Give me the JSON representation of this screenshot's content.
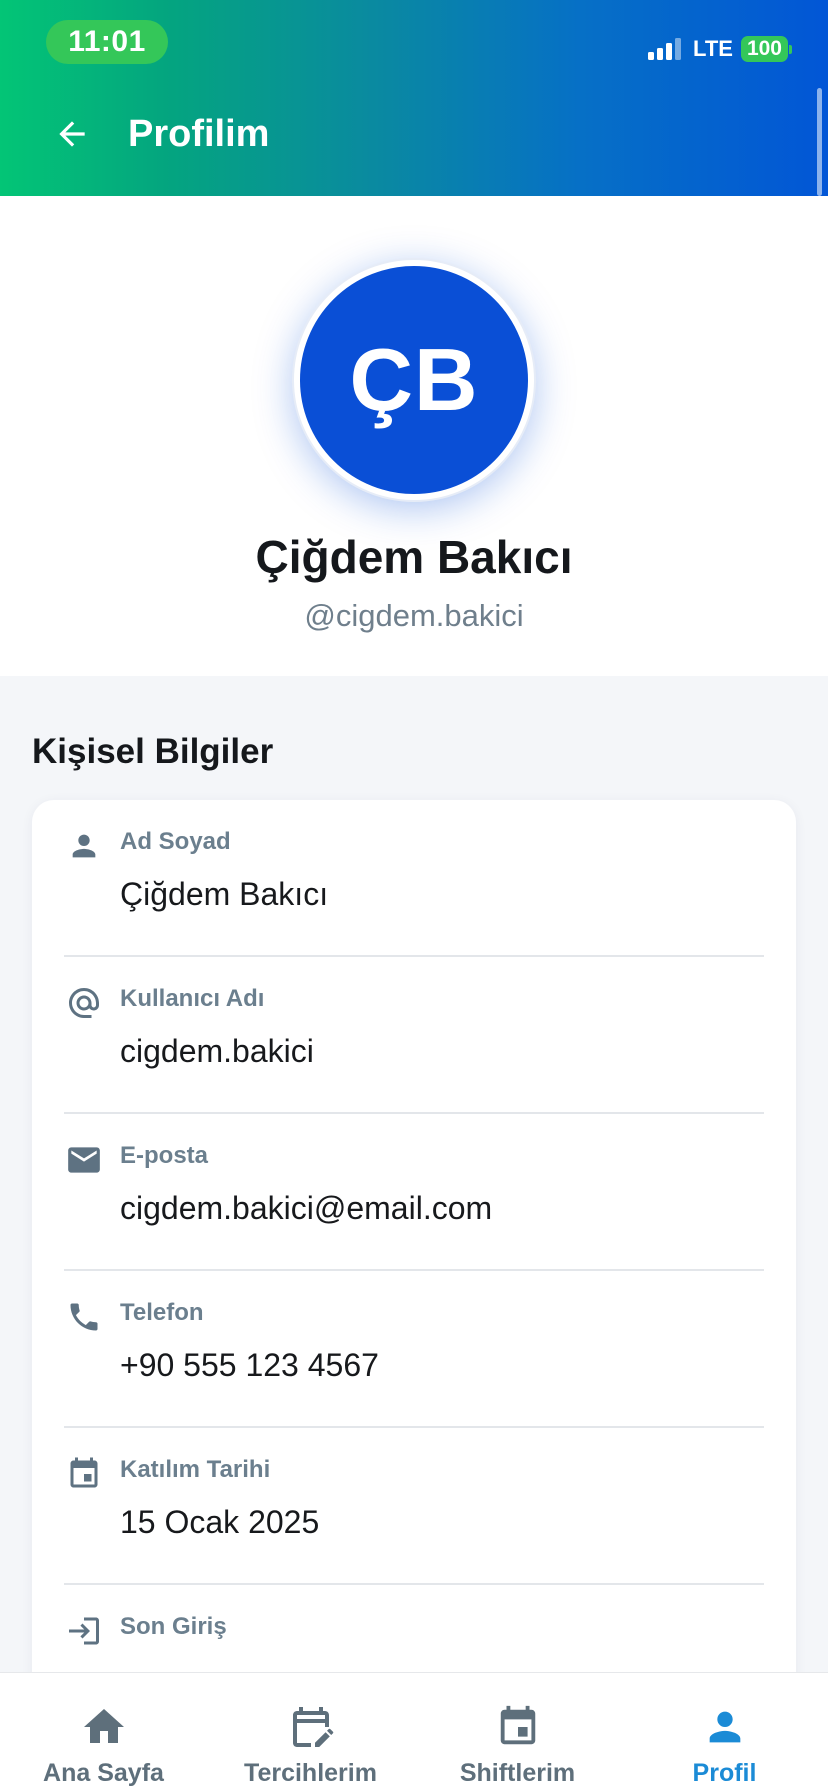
{
  "status_bar": {
    "time": "11:01",
    "network": "LTE",
    "battery": "100"
  },
  "header": {
    "title": "Profilim",
    "back_icon": "arrow-left-icon"
  },
  "profile": {
    "initials": "ÇB",
    "name": "Çiğdem Bakıcı",
    "handle": "@cigdem.bakici"
  },
  "personal_info": {
    "title": "Kişisel Bilgiler",
    "items": [
      {
        "label": "Ad Soyad",
        "value": "Çiğdem Bakıcı",
        "icon": "person-icon"
      },
      {
        "label": "Kullanıcı Adı",
        "value": "cigdem.bakici",
        "icon": "at-icon"
      },
      {
        "label": "E-posta",
        "value": "cigdem.bakici@email.com",
        "icon": "email-icon"
      },
      {
        "label": "Telefon",
        "value": "+90 555 123 4567",
        "icon": "phone-icon"
      },
      {
        "label": "Katılım Tarihi",
        "value": "15 Ocak 2025",
        "icon": "calendar-icon"
      },
      {
        "label": "Son Giriş",
        "value": "",
        "icon": "login-icon"
      }
    ]
  },
  "bottom_nav": {
    "items": [
      {
        "label": "Ana Sayfa",
        "icon": "home-icon",
        "active": false
      },
      {
        "label": "Tercihlerim",
        "icon": "calendar-edit-icon",
        "active": false
      },
      {
        "label": "Shiftlerim",
        "icon": "calendar-icon",
        "active": false
      },
      {
        "label": "Profil",
        "icon": "person-icon",
        "active": true
      }
    ]
  },
  "colors": {
    "accent": "#1b8bd6",
    "avatar": "#0a4fd6",
    "status_green": "#34c759",
    "icon_gray": "#5e6f7b"
  }
}
